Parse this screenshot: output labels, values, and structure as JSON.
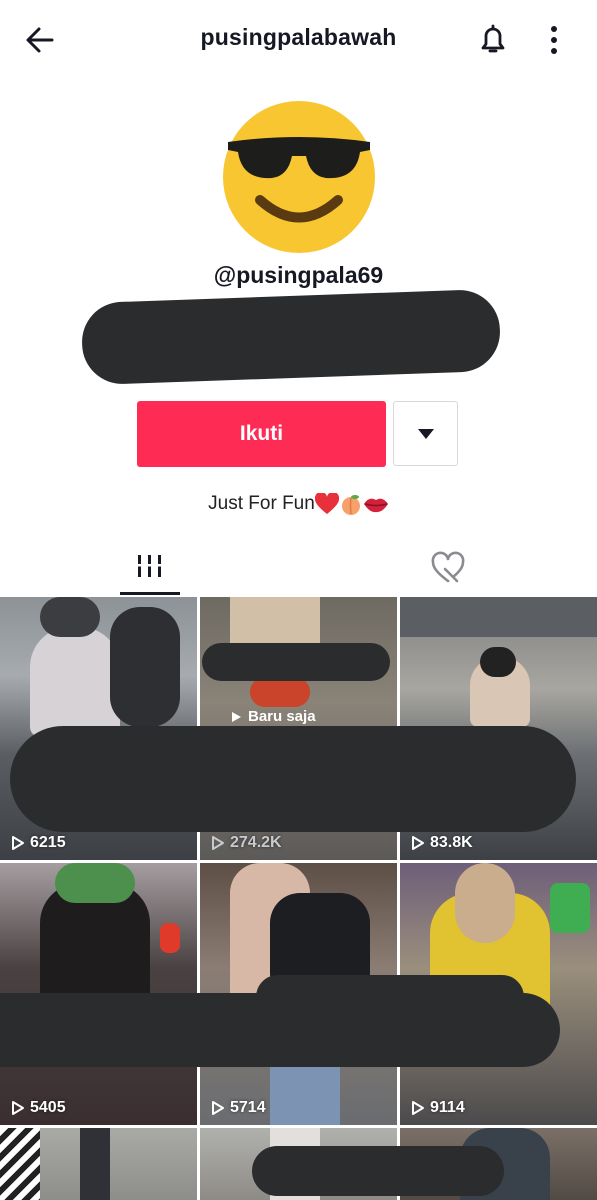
{
  "header": {
    "title": "pusingpalabawah",
    "back_icon": "arrow-left-icon",
    "bell_icon": "bell-icon",
    "more_icon": "more-vertical-icon"
  },
  "profile": {
    "avatar": "sunglasses-smiley-icon",
    "handle": "@pusingpala69",
    "follow_label": "Ikuti",
    "bio": "Just For Fun",
    "bio_emojis": [
      "heart-icon",
      "peach-icon",
      "lips-icon"
    ],
    "accent_color": "#fe2c55"
  },
  "tabs": [
    {
      "icon": "grid-icon",
      "active": true
    },
    {
      "icon": "liked-hidden-icon",
      "active": false
    }
  ],
  "videos": [
    {
      "views": "6215"
    },
    {
      "views": "274.2K",
      "badge": "Baru saja"
    },
    {
      "views": "83.8K"
    },
    {
      "views": "5405"
    },
    {
      "views": "5714"
    },
    {
      "views": "9114"
    },
    {
      "views": ""
    },
    {
      "views": ""
    },
    {
      "views": ""
    }
  ]
}
